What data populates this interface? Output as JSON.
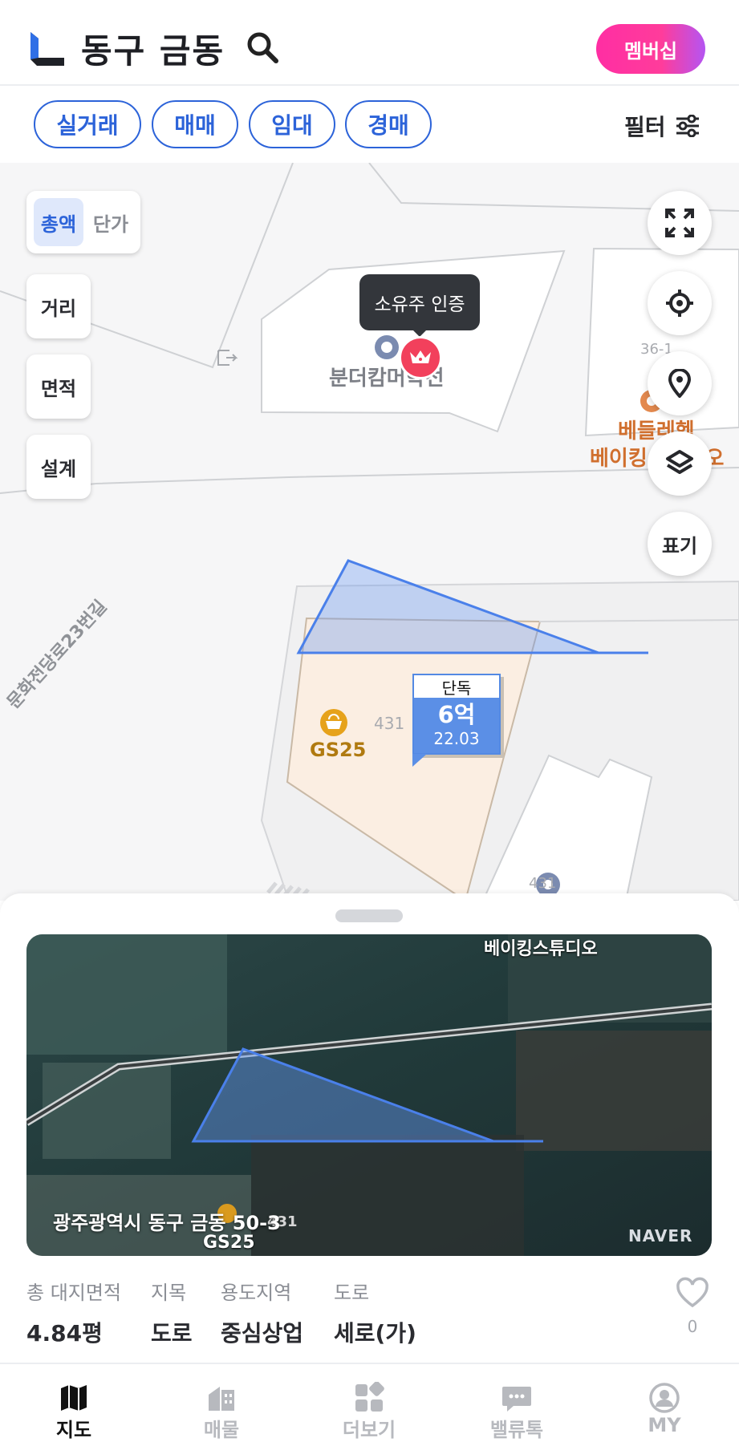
{
  "header": {
    "title": "동구 금동",
    "membership_label": "멤버십"
  },
  "filters": {
    "chips": [
      "실거래",
      "매매",
      "임대",
      "경매"
    ],
    "filter_label": "필터"
  },
  "map": {
    "toggle": {
      "active": "총액",
      "inactive": "단가"
    },
    "tools": [
      "거리",
      "면적",
      "설계"
    ],
    "display_label": "표기",
    "tooltip": "소유주 인증",
    "poi": {
      "school": "분더캄머학선",
      "bakery_line1": "베들레헴",
      "bakery_line2": "베이킹스튜디오",
      "parcel_36": "36-1",
      "parcel_431": "431",
      "parcel_431b": "431",
      "store": "GS25",
      "road": "문화전당로23번길"
    },
    "price_tag": {
      "type": "단독",
      "price": "6억",
      "date": "22.03"
    }
  },
  "detail": {
    "aerial_overlay_label": "베이킹스튜디오",
    "aerial_store": "GS25",
    "aerial_parcel": "431",
    "address": "광주광역시 동구 금동 50-3",
    "watermark": "NAVER",
    "stats": [
      {
        "label": "총 대지면적",
        "value": "4.84평"
      },
      {
        "label": "지목",
        "value": "도로"
      },
      {
        "label": "용도지역",
        "value": "중심상업"
      },
      {
        "label": "도로",
        "value": "세로(가)"
      }
    ],
    "favorite_count": "0"
  },
  "bottom_nav": [
    {
      "label": "지도",
      "icon": "map-icon",
      "active": true
    },
    {
      "label": "매물",
      "icon": "building-icon",
      "active": false
    },
    {
      "label": "더보기",
      "icon": "grid-icon",
      "active": false
    },
    {
      "label": "밸류톡",
      "icon": "chat-icon",
      "active": false
    },
    {
      "label": "MY",
      "icon": "user-icon",
      "active": false
    }
  ],
  "colors": {
    "accent": "#2c63d9",
    "membership_gradient_start": "#ff2ea3",
    "parcel_fill": "#fbeee2",
    "selection_outline": "#4a80ea",
    "crown_badge": "#f2405c"
  }
}
